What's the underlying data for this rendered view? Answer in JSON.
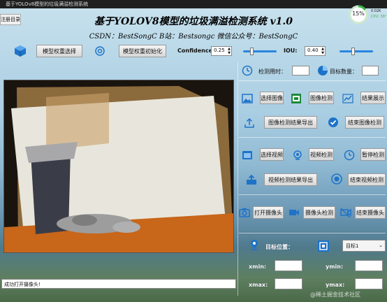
{
  "window": {
    "title": "基于YOLOv8模型的垃圾满溢检测系统",
    "menu_label": "注册目录"
  },
  "header": {
    "title": "基于YOLOV8模型的垃圾满溢检测系统 v1.0",
    "subtitle": "CSDN：BestSongC   B站：Bestsongc   微信公众号：BestSongC"
  },
  "cpu_widget": {
    "percent": "15%",
    "net_up": "0.02K",
    "cpu_label": "CPU: 39°"
  },
  "model_bar": {
    "select_weights_label": "模型权重选择",
    "init_weights_label": "模型权重初始化",
    "confidence_label": "Confidence:",
    "confidence_value": "0.25",
    "iou_label": "IOU:",
    "iou_value": "0.40",
    "confidence_fraction": 0.25,
    "iou_fraction": 0.4
  },
  "stats": {
    "time_label": "检测用时：",
    "time_value": "",
    "count_label": "目标数量：",
    "count_value": ""
  },
  "image_row": {
    "select_image_label": "选择图像",
    "detect_image_label": "图像检测",
    "show_results_label": "结果展示",
    "export_image_label": "图像检测结果导出",
    "end_image_label": "结束图像检测"
  },
  "video_row": {
    "select_video_label": "选择视频",
    "detect_video_label": "视频检测",
    "pause_label": "暂停检测",
    "export_video_label": "视频检测结果导出",
    "end_video_label": "结束视频检测"
  },
  "camera_row": {
    "open_camera_label": "打开摄像头",
    "camera_detect_label": "摄像头检测",
    "close_camera_label": "结束摄像头"
  },
  "target": {
    "position_label": "目标位置：",
    "select_value": "目标1",
    "xmin_label": "xmin:",
    "ymin_label": "ymin:",
    "xmax_label": "xmax:",
    "ymax_label": "ymax:",
    "xmin_value": "",
    "ymin_value": "",
    "xmax_value": "",
    "ymax_value": ""
  },
  "status": {
    "message": "成功打开摄像头!"
  },
  "watermark": "@稀土掘金技术社区",
  "colors": {
    "accent": "#2a84e0",
    "icon_blue": "#1e73c8",
    "cpu_ring": "#3bb54a"
  }
}
